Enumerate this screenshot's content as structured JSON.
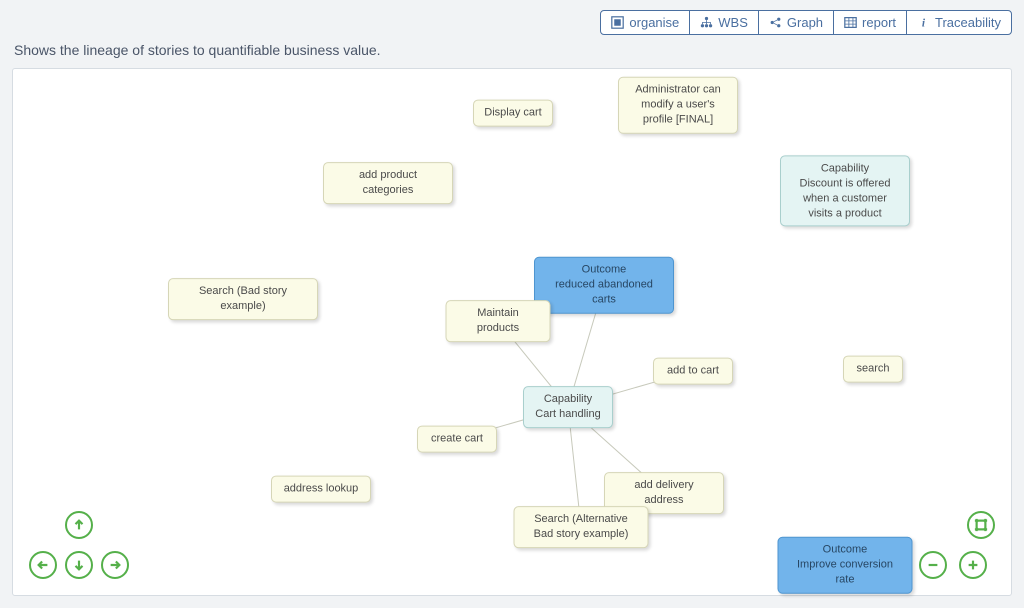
{
  "toolbar": {
    "organise": "organise",
    "wbs": "WBS",
    "graph": "Graph",
    "report": "report",
    "traceability": "Traceability"
  },
  "subtitle": "Shows the lineage of stories to quantifiable business value.",
  "nodes": {
    "display_cart": {
      "text": "Display cart"
    },
    "admin_modify": {
      "text": "Administrator can modify a user's profile [FINAL]"
    },
    "add_categories": {
      "text": "add product categories"
    },
    "capability_discount": {
      "title": "Capability",
      "text": "Discount is offered when a customer visits a product"
    },
    "search_bad": {
      "text": "Search (Bad story example)"
    },
    "outcome_abandon": {
      "title": "Outcome",
      "text": "reduced abandoned carts"
    },
    "maintain_products": {
      "text": "Maintain products"
    },
    "add_to_cart": {
      "text": "add to cart"
    },
    "search": {
      "text": "search"
    },
    "capability_cart": {
      "title": "Capability",
      "text": "Cart handling"
    },
    "create_cart": {
      "text": "create cart"
    },
    "address_lookup": {
      "text": "address lookup"
    },
    "add_delivery": {
      "text": "add delivery address"
    },
    "search_alt_bad": {
      "text": "Search (Alternative Bad story example)"
    },
    "outcome_conv": {
      "title": "Outcome",
      "text": "Improve conversion rate"
    }
  }
}
